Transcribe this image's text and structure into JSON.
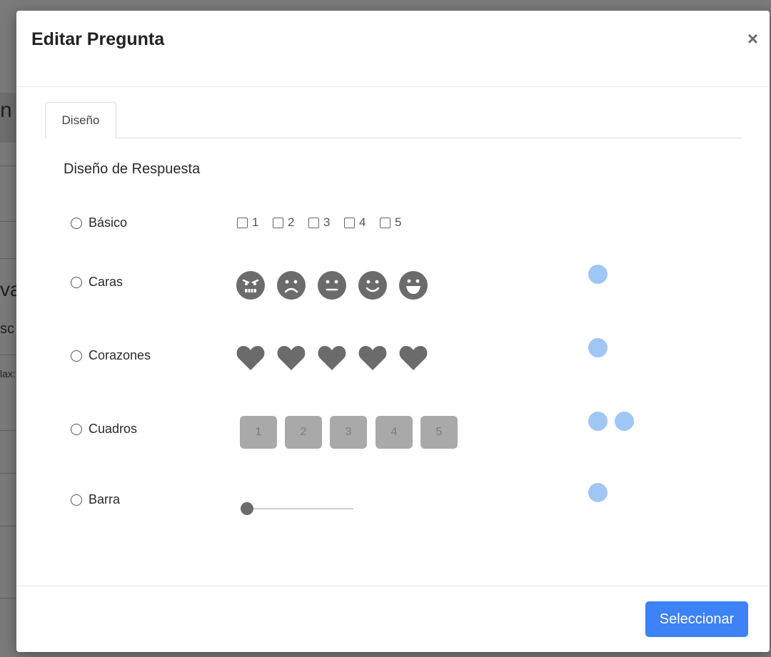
{
  "background": {
    "fragments": [
      "n",
      "va",
      "sc",
      "lax:"
    ]
  },
  "modal": {
    "title": "Editar Pregunta",
    "close_symbol": "×",
    "tabs": [
      {
        "label": "Diseño"
      }
    ],
    "section_title": "Diseño de Respuesta",
    "options": [
      {
        "label": "Básico"
      },
      {
        "label": "Caras"
      },
      {
        "label": "Corazones"
      },
      {
        "label": "Cuadros"
      },
      {
        "label": "Barra"
      }
    ],
    "basic_values": [
      "1",
      "2",
      "3",
      "4",
      "5"
    ],
    "faces": [
      "angry-face-icon",
      "sad-face-icon",
      "neutral-face-icon",
      "smile-face-icon",
      "grin-face-icon"
    ],
    "square_values": [
      "1",
      "2",
      "3",
      "4",
      "5"
    ],
    "slider_value": 0,
    "footer": {
      "select_label": "Seleccionar"
    }
  },
  "colors": {
    "accent": "#3d82f6",
    "icon_gray": "#6b6b6b",
    "square_gray": "#a9a9a9",
    "dot_blue": "#9fc6f4"
  }
}
